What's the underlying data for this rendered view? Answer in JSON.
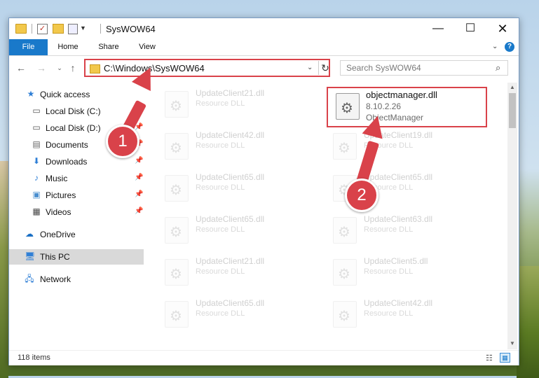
{
  "window": {
    "title": "SysWOW64",
    "controls": {
      "minimize": "—",
      "maximize": "☐",
      "close": "✕"
    }
  },
  "ribbon": {
    "tabs": [
      "File",
      "Home",
      "Share",
      "View"
    ],
    "help": "?"
  },
  "address_bar": {
    "path": "C:\\Windows\\SysWOW64"
  },
  "search": {
    "placeholder": "Search SysWOW64"
  },
  "sidebar": {
    "items": [
      {
        "label": "Quick access",
        "icon": "star-icon"
      },
      {
        "label": "Local Disk (C:)",
        "icon": "drive-icon",
        "pinned": true
      },
      {
        "label": "Local Disk (D:)",
        "icon": "drive-icon",
        "pinned": true
      },
      {
        "label": "Documents",
        "icon": "documents-icon",
        "pinned": true
      },
      {
        "label": "Downloads",
        "icon": "downloads-icon",
        "pinned": true
      },
      {
        "label": "Music",
        "icon": "music-icon",
        "pinned": true
      },
      {
        "label": "Pictures",
        "icon": "pictures-icon",
        "pinned": true
      },
      {
        "label": "Videos",
        "icon": "videos-icon",
        "pinned": true
      },
      {
        "label": "OneDrive",
        "icon": "cloud-icon"
      },
      {
        "label": "This PC",
        "icon": "computer-icon",
        "selected": true
      },
      {
        "label": "Network",
        "icon": "network-icon"
      }
    ]
  },
  "files": {
    "highlighted": {
      "name": "objectmanager.dll",
      "version": "8.10.2.26",
      "description": "ObjectManager"
    },
    "tiles": [
      {
        "name": "UpdateClient21.dll",
        "type": "Resource DLL"
      },
      {
        "name": "UpdateClient42.dll",
        "type": "Resource DLL"
      },
      {
        "name": "UpdateClient19.dll",
        "type": "Resource DLL"
      },
      {
        "name": "UpdateClient65.dll",
        "type": "Resource DLL"
      },
      {
        "name": "UpdateClient65.dll",
        "type": "Resource DLL"
      },
      {
        "name": "UpdateClient65.dll",
        "type": "Resource DLL"
      },
      {
        "name": "UpdateClient63.dll",
        "type": "Resource DLL"
      },
      {
        "name": "UpdateClient21.dll",
        "type": "Resource DLL"
      },
      {
        "name": "UpdateClient5.dll",
        "type": "Resource DLL"
      },
      {
        "name": "UpdateClient65.dll",
        "type": "Resource DLL"
      },
      {
        "name": "UpdateClient42.dll",
        "type": "Resource DLL"
      }
    ]
  },
  "status": {
    "item_count": "118 items"
  },
  "annotations": {
    "step1": "1",
    "step2": "2",
    "color": "#d9424a"
  }
}
